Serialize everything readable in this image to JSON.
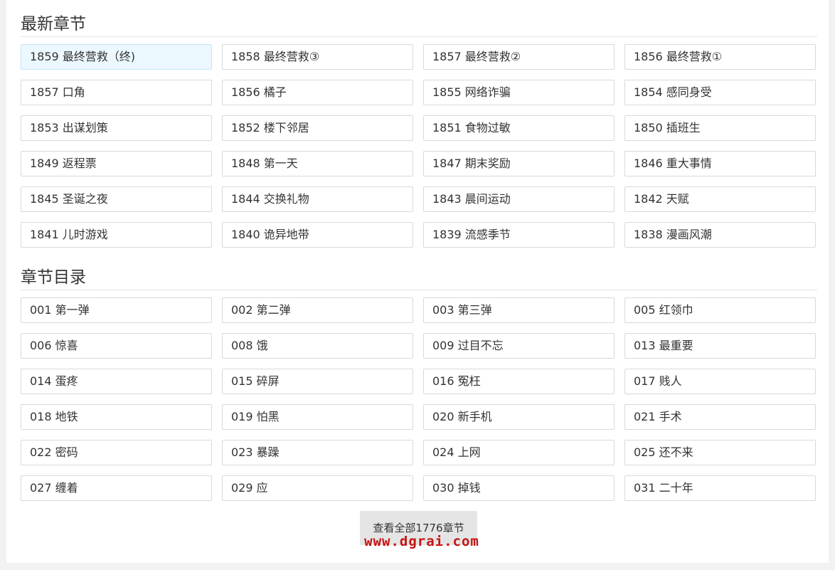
{
  "latest": {
    "title": "最新章节",
    "items": [
      "1859 最终营救（终)",
      "1858 最终营救③",
      "1857 最终营救②",
      "1856 最终营救①",
      "1857 口角",
      "1856 橘子",
      "1855 网络诈骗",
      "1854 感同身受",
      "1853 出谋划策",
      "1852 楼下邻居",
      "1851 食物过敏",
      "1850 插班生",
      "1849 返程票",
      "1848 第一天",
      "1847 期末奖励",
      "1846 重大事情",
      "1845 圣诞之夜",
      "1844 交换礼物",
      "1843 晨间运动",
      "1842 天赋",
      "1841 儿时游戏",
      "1840 诡异地带",
      "1839 流感季节",
      "1838 漫画风潮"
    ]
  },
  "catalog": {
    "title": "章节目录",
    "items": [
      "001 第一弹",
      "002 第二弹",
      "003 第三弹",
      "005 红领巾",
      "006 惊喜",
      "008 饿",
      "009 过目不忘",
      "013 最重要",
      "014 蛋疼",
      "015 碎屏",
      "016 冤枉",
      "017 贱人",
      "018 地铁",
      "019 怕黑",
      "020 新手机",
      "021 手术",
      "022 密码",
      "023 暴躁",
      "024 上网",
      "025 还不来",
      "027 缠着",
      "029 应",
      "030 掉钱",
      "031 二十年"
    ]
  },
  "more_button": "查看全部1776章节",
  "watermark": "www.dgrai.com"
}
